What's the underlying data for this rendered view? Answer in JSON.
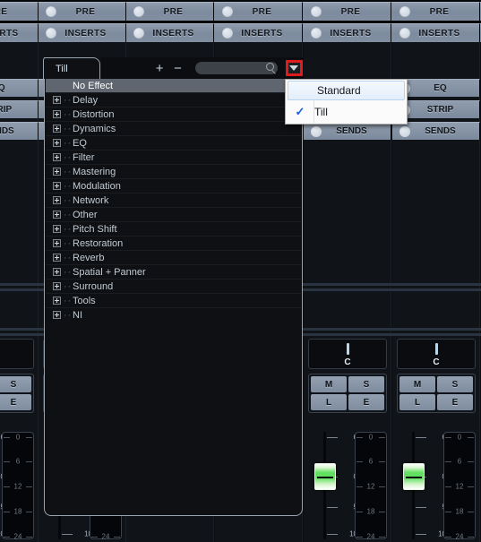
{
  "mixer": {
    "top_rows": [
      {
        "label": "PRE",
        "icon": "led-indicator"
      },
      {
        "label": "INSERTS",
        "icon": "led-indicator"
      }
    ],
    "left_partial_labels": [
      "E",
      "RTS"
    ],
    "left_edge_buttons": [
      "P",
      "DS"
    ],
    "right_buttons": [
      {
        "label": "EQ"
      },
      {
        "label": "STRIP"
      },
      {
        "label": "SENDS"
      }
    ],
    "channel_count": 5,
    "pan": {
      "value": "C"
    },
    "transport_buttons": [
      "M",
      "S",
      "L",
      "E"
    ],
    "fader": {
      "scale": [
        "6",
        "0",
        "5",
        "10"
      ],
      "position_label": "0",
      "color": "#61e060"
    },
    "meter": {
      "scale": [
        "0",
        "6",
        "12",
        "18",
        "24"
      ]
    }
  },
  "browser": {
    "tab": {
      "label": "Till"
    },
    "toolbar": {
      "add_label": "+",
      "remove_label": "−",
      "search_value": "",
      "search_placeholder": "",
      "search_icon": "magnifier-icon",
      "dropdown_icon": "chevron-down-icon"
    },
    "list": [
      {
        "label": "No Effect",
        "expandable": false,
        "selected": true
      },
      {
        "label": "Delay",
        "expandable": true,
        "selected": false
      },
      {
        "label": "Distortion",
        "expandable": true,
        "selected": false
      },
      {
        "label": "Dynamics",
        "expandable": true,
        "selected": false
      },
      {
        "label": "EQ",
        "expandable": true,
        "selected": false
      },
      {
        "label": "Filter",
        "expandable": true,
        "selected": false
      },
      {
        "label": "Mastering",
        "expandable": true,
        "selected": false
      },
      {
        "label": "Modulation",
        "expandable": true,
        "selected": false
      },
      {
        "label": "Network",
        "expandable": true,
        "selected": false
      },
      {
        "label": "Other",
        "expandable": true,
        "selected": false
      },
      {
        "label": "Pitch Shift",
        "expandable": true,
        "selected": false
      },
      {
        "label": "Restoration",
        "expandable": true,
        "selected": false
      },
      {
        "label": "Reverb",
        "expandable": true,
        "selected": false
      },
      {
        "label": "Spatial + Panner",
        "expandable": true,
        "selected": false
      },
      {
        "label": "Surround",
        "expandable": true,
        "selected": false
      },
      {
        "label": "Tools",
        "expandable": true,
        "selected": false
      },
      {
        "label": "NI",
        "expandable": true,
        "selected": false
      }
    ]
  },
  "dropdown_menu": {
    "items": [
      {
        "label": "Standard",
        "checked": false,
        "highlighted": true
      },
      {
        "label": "Till",
        "checked": true,
        "highlighted": false
      }
    ],
    "check_glyph": "✓"
  },
  "colors": {
    "accent_red": "#e01b1b",
    "fader_green": "#61e060",
    "button_blue_grey": "#8895a7",
    "menu_check_blue": "#1b5fd8"
  }
}
